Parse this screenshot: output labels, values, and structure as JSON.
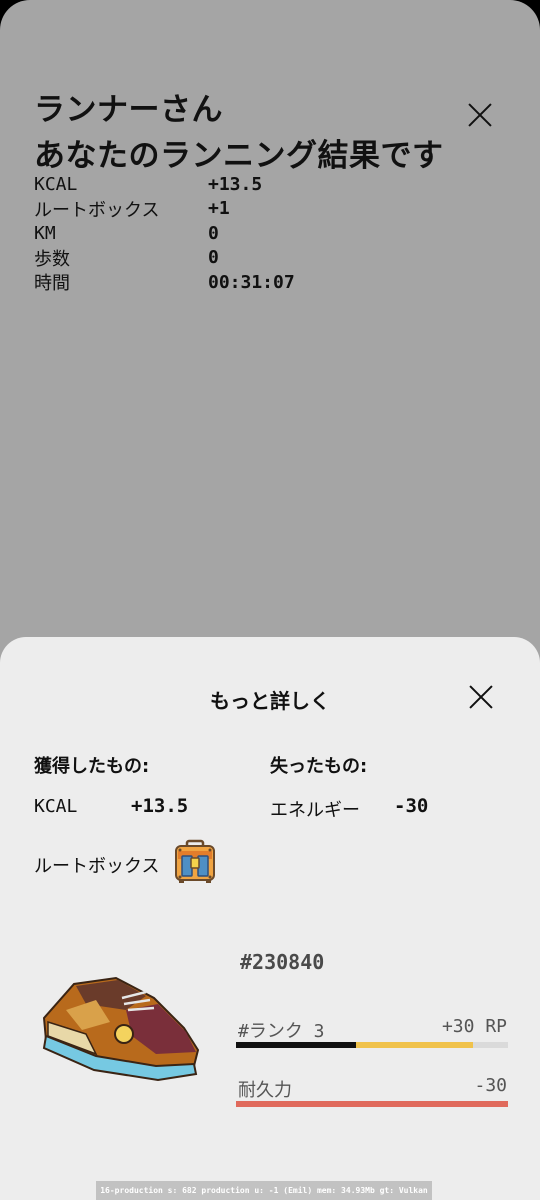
{
  "result_screen": {
    "greeting": "ランナーさん",
    "headline": "あなたのランニング結果です",
    "stats": [
      {
        "label": "KCAL",
        "value": "+13.5"
      },
      {
        "label": "ルートボックス",
        "value": "+1"
      },
      {
        "label": "KM",
        "value": "0"
      },
      {
        "label": "歩数",
        "value": "0"
      },
      {
        "label": "時間",
        "value": "00:31:07"
      }
    ]
  },
  "details_sheet": {
    "title": "もっと詳しく",
    "gained_heading": "獲得したもの:",
    "lost_heading": "失ったもの:",
    "gained_kcal_label": "KCAL",
    "gained_kcal_value": "+13.5",
    "lost_energy_label": "エネルギー",
    "lost_energy_value": "-30",
    "lootbox_label": "ルートボックス",
    "lootbox_icon": "lootbox-icon",
    "sneaker": {
      "id": "#230840",
      "rank_label": "#ランク 3",
      "rank_points": "+30 RP",
      "rank_progress_before": 0.44,
      "rank_progress_after": 0.87,
      "durability_label": "耐久力",
      "durability_change": "-30",
      "durability_level": 1.0
    }
  },
  "debug_overlay": "16-production  s: 682  production  u: -1 (Emil)   mem: 34.93Mb  gt: Vulkan",
  "colors": {
    "dim_background": "#a5a5a5",
    "sheet_background": "#ededed",
    "rank_bar_before": "#111111",
    "rank_bar_gain": "#f0c24b",
    "durability_bar": "#e06a5c"
  }
}
